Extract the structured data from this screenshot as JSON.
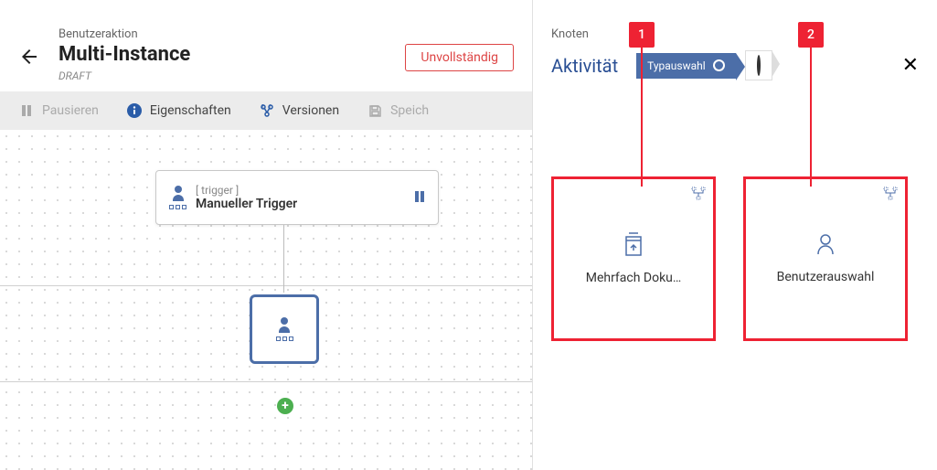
{
  "header": {
    "supertitle": "Benutzeraktion",
    "title": "Multi-Instance",
    "state": "DRAFT",
    "status_pill": "Unvollständig"
  },
  "toolbar": {
    "pause": "Pausieren",
    "properties": "Eigenschaften",
    "versions": "Versionen",
    "save": "Speich"
  },
  "workflow": {
    "trigger_tag": "[ trigger ]",
    "trigger_name": "Manueller Trigger"
  },
  "right": {
    "supertitle": "Knoten",
    "title": "Aktivität",
    "step_label": "Typauswahl"
  },
  "cards": [
    {
      "label": "Mehrfach Doku…"
    },
    {
      "label": "Benutzerauswahl"
    }
  ],
  "markers": [
    "1",
    "2"
  ]
}
